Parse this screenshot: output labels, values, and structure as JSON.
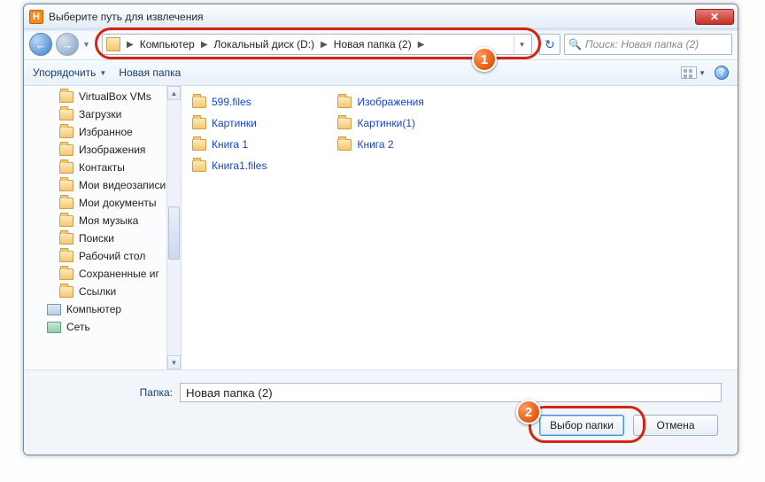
{
  "titlebar": {
    "app_letter": "H",
    "title": "Выберите путь для извлечения"
  },
  "address": {
    "crumbs": [
      "Компьютер",
      "Локальный диск (D:)",
      "Новая папка (2)"
    ],
    "search_placeholder": "Поиск: Новая папка (2)"
  },
  "toolbar": {
    "organize": "Упорядочить",
    "new_folder": "Новая папка",
    "help_glyph": "?"
  },
  "sidebar": {
    "items": [
      {
        "label": "VirtualBox VMs",
        "type": "folder"
      },
      {
        "label": "Загрузки",
        "type": "folder"
      },
      {
        "label": "Избранное",
        "type": "folder"
      },
      {
        "label": "Изображения",
        "type": "folder"
      },
      {
        "label": "Контакты",
        "type": "folder"
      },
      {
        "label": "Мои видеозаписи",
        "type": "folder"
      },
      {
        "label": "Мои документы",
        "type": "folder"
      },
      {
        "label": "Моя музыка",
        "type": "folder"
      },
      {
        "label": "Поиски",
        "type": "folder"
      },
      {
        "label": "Рабочий стол",
        "type": "folder"
      },
      {
        "label": "Сохраненные иг",
        "type": "folder"
      },
      {
        "label": "Ссылки",
        "type": "folder"
      },
      {
        "label": "Компьютер",
        "type": "computer"
      },
      {
        "label": "Сеть",
        "type": "network"
      }
    ]
  },
  "files": {
    "col1": [
      {
        "label": "599.files"
      },
      {
        "label": "Картинки"
      },
      {
        "label": "Книга 1"
      },
      {
        "label": "Книга1.files"
      }
    ],
    "col2": [
      {
        "label": "Изображения"
      },
      {
        "label": "Картинки(1)"
      },
      {
        "label": "Книга 2"
      }
    ]
  },
  "bottom": {
    "folder_label": "Папка:",
    "folder_value": "Новая папка (2)",
    "select_btn": "Выбор папки",
    "cancel_btn": "Отмена"
  },
  "callouts": {
    "one": "1",
    "two": "2"
  }
}
